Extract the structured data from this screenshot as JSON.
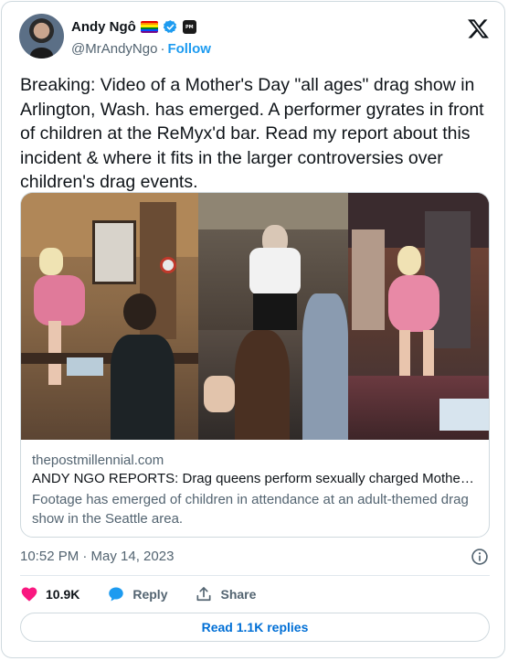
{
  "author": {
    "display_name": "Andy Ngô",
    "handle": "@MrAndyNgo",
    "separator": "·",
    "follow_label": "Follow",
    "affiliate_badge_text": "PM"
  },
  "tweet": {
    "text": "Breaking: Video of a Mother's Day \"all ages\" drag show in Arlington, Wash. has emerged. A performer gyrates in front of children at the ReMyx'd bar. Read my report about this incident & where it fits in the larger controversies over children's drag events."
  },
  "link_card": {
    "domain": "thepostmillennial.com",
    "title": "ANDY NGO REPORTS: Drag queens perform sexually charged Mother's ...",
    "description": "Footage has emerged of children in attendance at an adult-themed drag show in the Seattle area."
  },
  "meta": {
    "timestamp": "10:52 PM · May 14, 2023"
  },
  "actions": {
    "like_count": "10.9K",
    "reply_label": "Reply",
    "share_label": "Share"
  },
  "replies_button": {
    "label": "Read 1.1K replies"
  },
  "colors": {
    "accent": "#1d9bf0",
    "link_button": "#006fd6",
    "like": "#f91880",
    "secondary_text": "#536471",
    "border": "#cfd9de"
  },
  "icons": {
    "x_logo": "x-logo-icon",
    "verified": "verified-badge-icon",
    "info": "info-icon",
    "like": "heart-icon",
    "reply": "speech-bubble-icon",
    "share": "share-upload-icon"
  }
}
